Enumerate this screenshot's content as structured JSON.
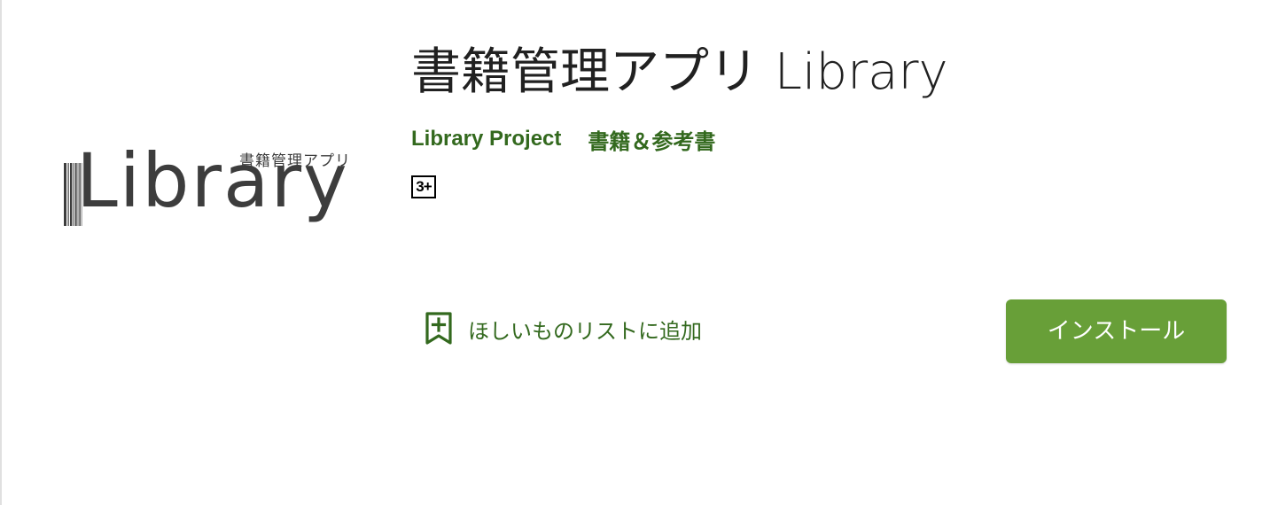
{
  "app": {
    "title": "書籍管理アプリ Library",
    "developer": "Library Project",
    "category": "書籍＆参考書",
    "content_rating": "3+"
  },
  "logo": {
    "wordmark": "Library",
    "caption": "書籍管理アプリ",
    "color": "#3d3d3d"
  },
  "actions": {
    "wishlist_label": "ほしいものリストに追加",
    "wishlist_icon": "bookmark-add-icon",
    "install_label": "インストール"
  },
  "colors": {
    "accent_text": "#33691e",
    "install_button": "#689f38",
    "title_text": "#212121"
  }
}
